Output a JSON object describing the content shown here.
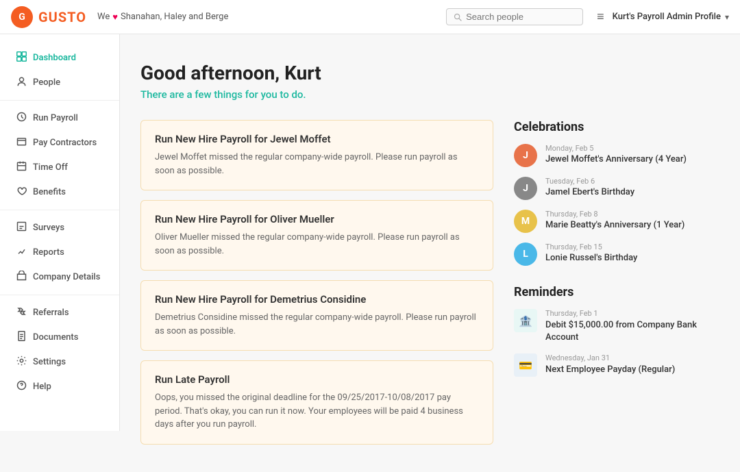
{
  "topnav": {
    "logo_text": "GUSTO",
    "logo_letter": "G",
    "company_pre": "We",
    "heart": "♥",
    "company_name": "Shanahan, Haley and Berge",
    "search_placeholder": "Search people",
    "profile_label": "Kurt's Payroll Admin Profile"
  },
  "sidebar": {
    "items": [
      {
        "id": "dashboard",
        "label": "Dashboard",
        "icon": "⊞",
        "active": true
      },
      {
        "id": "people",
        "label": "People",
        "icon": "👤",
        "active": false
      },
      {
        "id": "run-payroll",
        "label": "Run Payroll",
        "icon": "💰",
        "active": false
      },
      {
        "id": "pay-contractors",
        "label": "Pay Contractors",
        "icon": "📋",
        "active": false
      },
      {
        "id": "time-off",
        "label": "Time Off",
        "icon": "🏖",
        "active": false
      },
      {
        "id": "benefits",
        "label": "Benefits",
        "icon": "❤",
        "active": false
      },
      {
        "id": "surveys",
        "label": "Surveys",
        "icon": "📊",
        "active": false
      },
      {
        "id": "reports",
        "label": "Reports",
        "icon": "📈",
        "active": false
      },
      {
        "id": "company-details",
        "label": "Company Details",
        "icon": "🏢",
        "active": false
      },
      {
        "id": "referrals",
        "label": "Referrals",
        "icon": "🎁",
        "active": false
      },
      {
        "id": "documents",
        "label": "Documents",
        "icon": "📄",
        "active": false
      },
      {
        "id": "settings",
        "label": "Settings",
        "icon": "⚙",
        "active": false
      },
      {
        "id": "help",
        "label": "Help",
        "icon": "❓",
        "active": false
      }
    ]
  },
  "main": {
    "greeting": "Good afternoon, Kurt",
    "subtitle": "There are a few things for you to do.",
    "tasks": [
      {
        "id": "task-jewel",
        "title": "Run New Hire Payroll for Jewel Moffet",
        "description": "Jewel Moffet missed the regular company-wide payroll. Please run payroll as soon as possible."
      },
      {
        "id": "task-oliver",
        "title": "Run New Hire Payroll for Oliver Mueller",
        "description": "Oliver Mueller missed the regular company-wide payroll. Please run payroll as soon as possible."
      },
      {
        "id": "task-demetrius",
        "title": "Run New Hire Payroll for Demetrius Considine",
        "description": "Demetrius Considine missed the regular company-wide payroll. Please run payroll as soon as possible."
      },
      {
        "id": "task-late",
        "title": "Run Late Payroll",
        "description": "Oops, you missed the original deadline for the 09/25/2017-10/08/2017 pay period. That's okay, you can run it now. Your employees will be paid 4 business days after you run payroll."
      }
    ]
  },
  "celebrations": {
    "title": "Celebrations",
    "items": [
      {
        "id": "cel-jewel",
        "date": "Monday, Feb 5",
        "name": "Jewel Moffet's Anniversary (4 Year)",
        "initials": "J",
        "color": "#e8734a"
      },
      {
        "id": "cel-jamel",
        "date": "Tuesday, Feb 6",
        "name": "Jamel Ebert's Birthday",
        "initials": "J",
        "color": "#888"
      },
      {
        "id": "cel-marie",
        "date": "Thursday, Feb 8",
        "name": "Marie Beatty's Anniversary (1 Year)",
        "initials": "M",
        "color": "#e8c24a"
      },
      {
        "id": "cel-lonie",
        "date": "Thursday, Feb 15",
        "name": "Lonie Russel's Birthday",
        "initials": "L",
        "color": "#4ab8e8"
      }
    ]
  },
  "reminders": {
    "title": "Reminders",
    "items": [
      {
        "id": "rem-debit",
        "date": "Thursday, Feb 1",
        "text": "Debit $15,000.00 from Company Bank Account",
        "icon": "🏦",
        "icon_bg": "#e8f7f5"
      },
      {
        "id": "rem-payday",
        "date": "Wednesday, Jan 31",
        "text": "Next Employee Payday (Regular)",
        "icon": "💳",
        "icon_bg": "#e8f0f7"
      }
    ]
  }
}
